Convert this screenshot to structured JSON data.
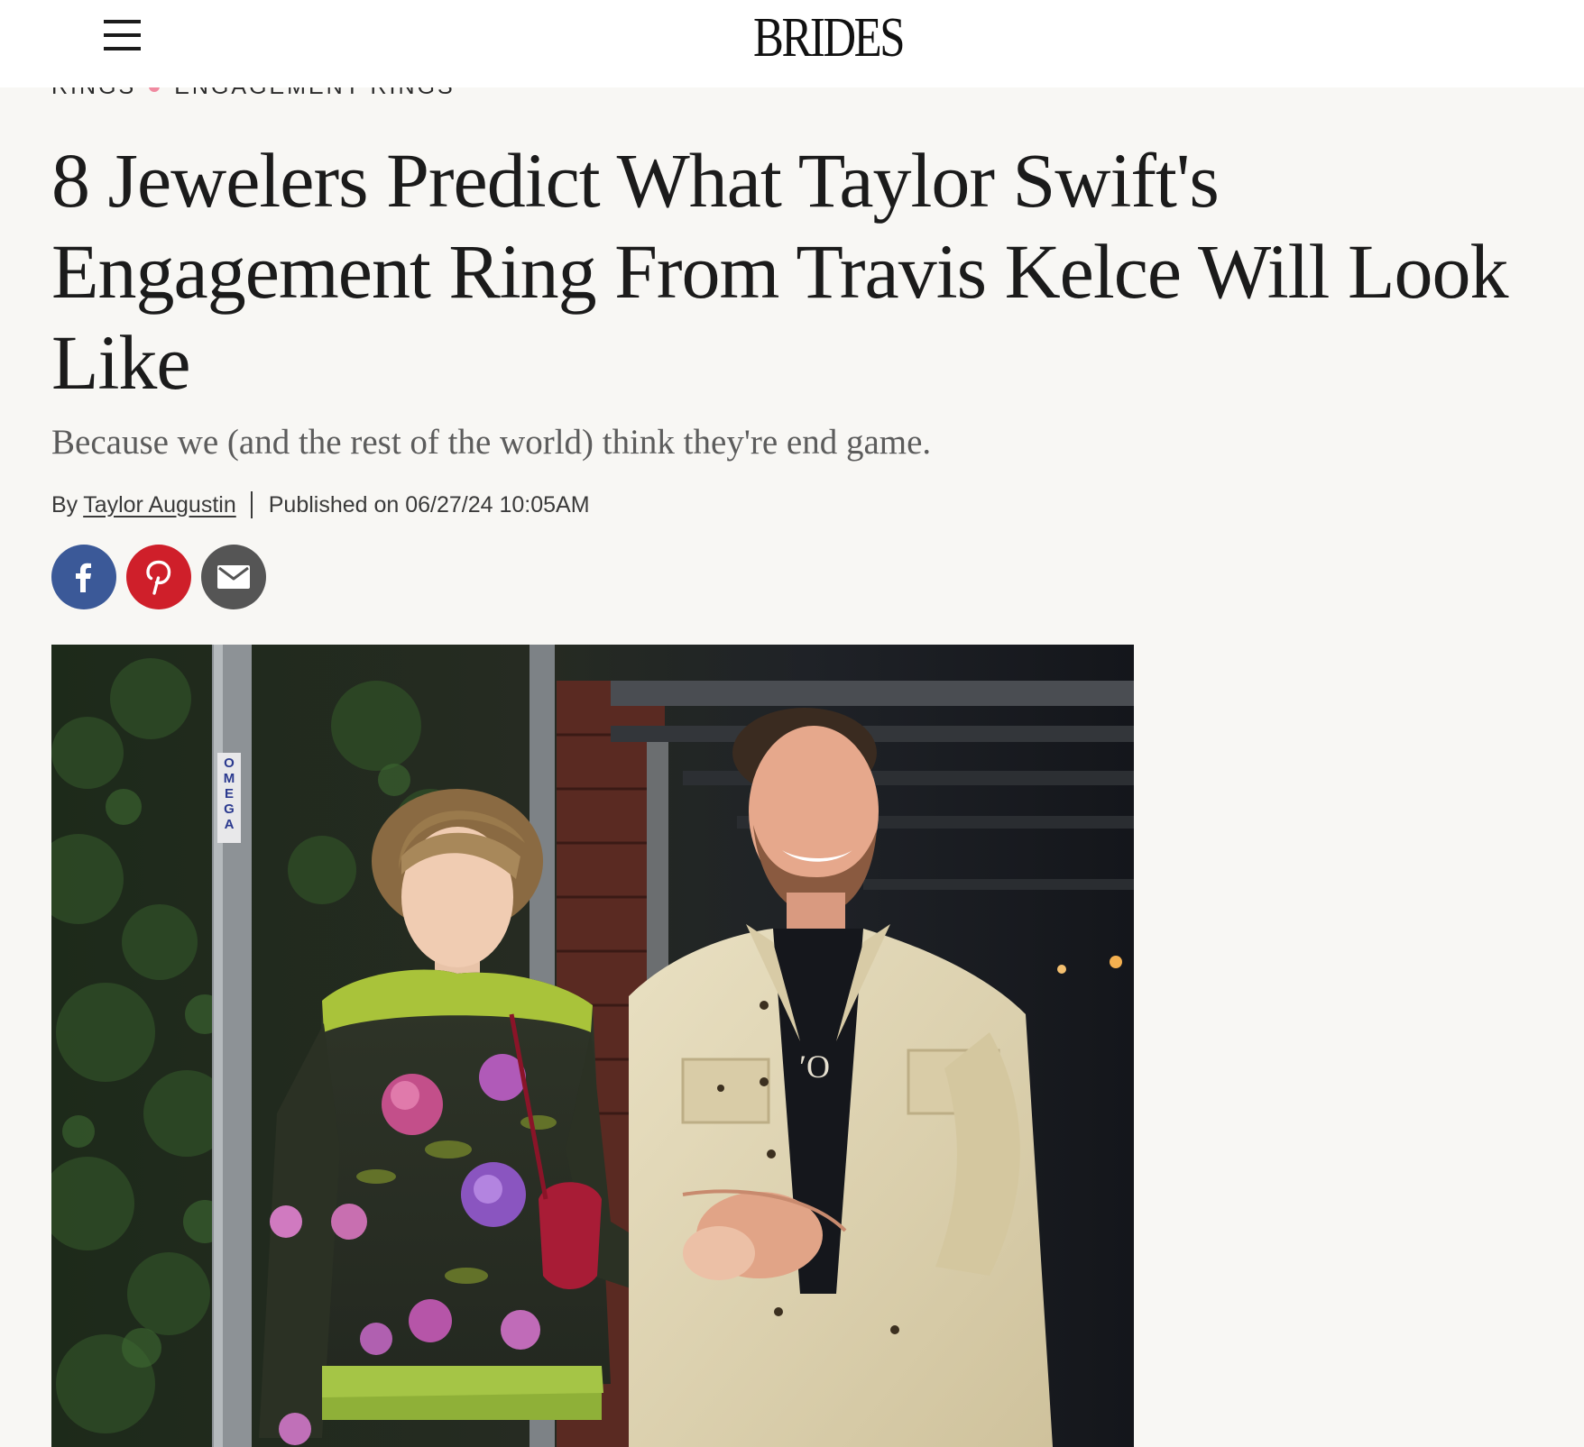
{
  "header": {
    "logo_text": "BRIDES",
    "menu_icon": "hamburger-menu-icon"
  },
  "breadcrumb": {
    "items": [
      "RINGS",
      "ENGAGEMENT RINGS"
    ],
    "separator_color": "#f08aa0"
  },
  "article": {
    "title": "8 Jewelers Predict What Taylor Swift's Engagement Ring From Travis Kelce Will Look Like",
    "dek": "Because we (and the rest of the world) think they're end game.",
    "byline_prefix": "By",
    "author": "Taylor Augustin",
    "published": "Published on 06/27/24 10:05AM"
  },
  "share": [
    {
      "name": "facebook",
      "icon": "facebook-icon",
      "color": "#3b5998"
    },
    {
      "name": "pinterest",
      "icon": "pinterest-icon",
      "color": "#cf1f2a"
    },
    {
      "name": "email",
      "icon": "email-icon",
      "color": "#555555"
    }
  ],
  "hero_image": {
    "sign_text": "OMEGA"
  },
  "colors": {
    "background": "#f8f7f4",
    "header_bg": "#ffffff",
    "text": "#1b1b1b",
    "dek": "#5c5c5c"
  }
}
